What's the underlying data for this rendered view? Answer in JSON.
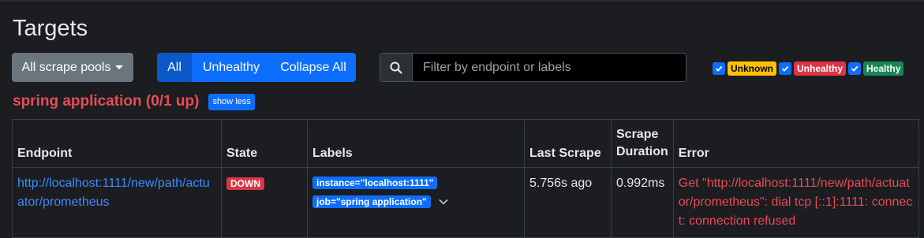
{
  "page_title": "Targets",
  "toolbar": {
    "pools_label": "All scrape pools",
    "group": [
      "All",
      "Unhealthy",
      "Collapse All"
    ],
    "search_placeholder": "Filter by endpoint or labels"
  },
  "filters": {
    "unknown": "Unknown",
    "unhealthy": "Unhealthy",
    "healthy": "Healthy"
  },
  "pool": {
    "title": "spring application (0/1 up)",
    "toggle_label": "show less"
  },
  "table": {
    "headers": {
      "endpoint": "Endpoint",
      "state": "State",
      "labels": "Labels",
      "last_scrape": "Last Scrape",
      "duration": "Scrape Duration",
      "error": "Error"
    },
    "rows": [
      {
        "endpoint": "http://localhost:1111/new/path/actuator/prometheus",
        "state": "DOWN",
        "labels": [
          "instance=\"localhost:1111\"",
          "job=\"spring application\""
        ],
        "last_scrape": "5.756s ago",
        "duration": "0.992ms",
        "error": "Get \"http://localhost:1111/new/path/actuator/prometheus\": dial tcp [::1]:1111: connect: connection refused"
      }
    ]
  },
  "colors": {
    "background": "#1b1d21",
    "primary": "#0d6efd",
    "danger": "#dc3545",
    "warning": "#ffc107",
    "success": "#198754"
  }
}
